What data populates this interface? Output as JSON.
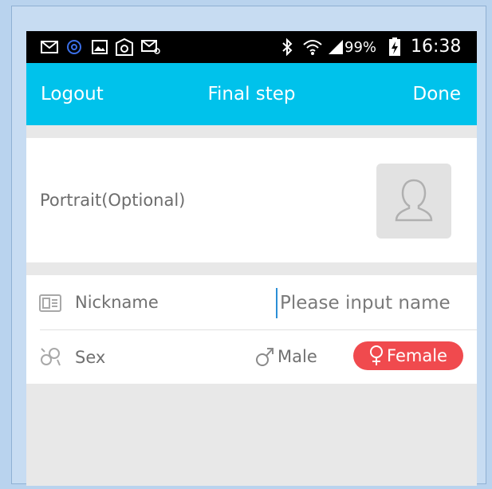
{
  "status_bar": {
    "battery": "99%",
    "time": "16:38",
    "icons": [
      "mail-icon",
      "at-sign-icon",
      "image-icon",
      "at-circle-icon",
      "email-at-icon",
      "bluetooth-icon",
      "wifi-icon",
      "signal-icon",
      "battery-charging-icon"
    ]
  },
  "header": {
    "left_label": "Logout",
    "title": "Final step",
    "right_label": "Done",
    "color": "#00c2eb"
  },
  "portrait": {
    "label": "Portrait(Optional)",
    "icon": "user-silhouette-icon"
  },
  "form": {
    "nickname_label": "Nickname",
    "nickname_placeholder": "Please input name",
    "nickname_value": "",
    "sex_label": "Sex",
    "male_label": "Male",
    "female_label": "Female",
    "selected": "Female",
    "selected_color": "#f04a4e"
  }
}
